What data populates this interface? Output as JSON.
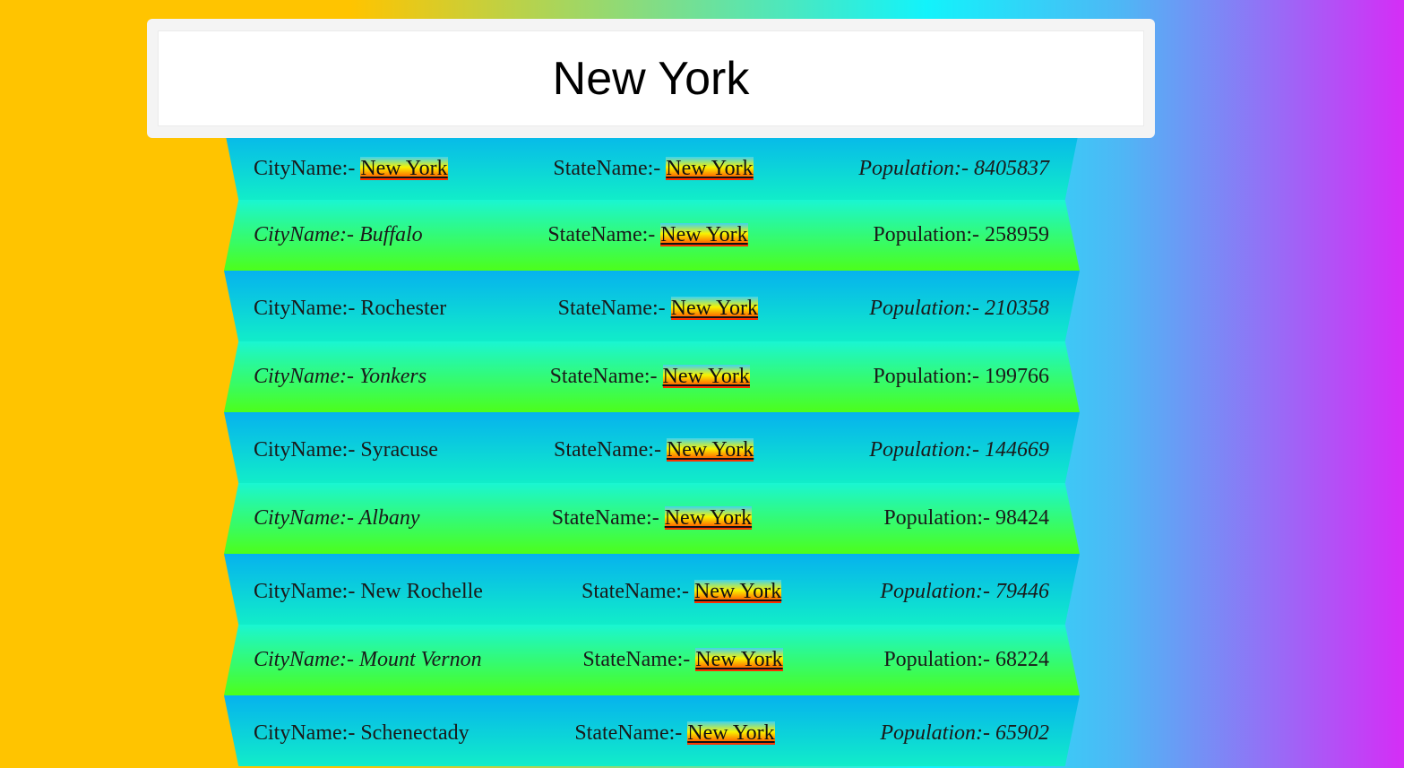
{
  "search": {
    "value": "New York",
    "placeholder": ""
  },
  "labels": {
    "city": "CityName:- ",
    "state": "StateName:- ",
    "population": "Population:- "
  },
  "highlight_colors": [
    "#3fd3ef",
    "#f8f300",
    "#ff6a00"
  ],
  "rows": [
    {
      "city": "New York",
      "state": "New York",
      "population": "8405837"
    },
    {
      "city": "Buffalo",
      "state": "New York",
      "population": "258959"
    },
    {
      "city": "Rochester",
      "state": "New York",
      "population": "210358"
    },
    {
      "city": "Yonkers",
      "state": "New York",
      "population": "199766"
    },
    {
      "city": "Syracuse",
      "state": "New York",
      "population": "144669"
    },
    {
      "city": "Albany",
      "state": "New York",
      "population": "98424"
    },
    {
      "city": "New Rochelle",
      "state": "New York",
      "population": "79446"
    },
    {
      "city": "Mount Vernon",
      "state": "New York",
      "population": "68224"
    },
    {
      "city": "Schenectady",
      "state": "New York",
      "population": "65902"
    }
  ]
}
